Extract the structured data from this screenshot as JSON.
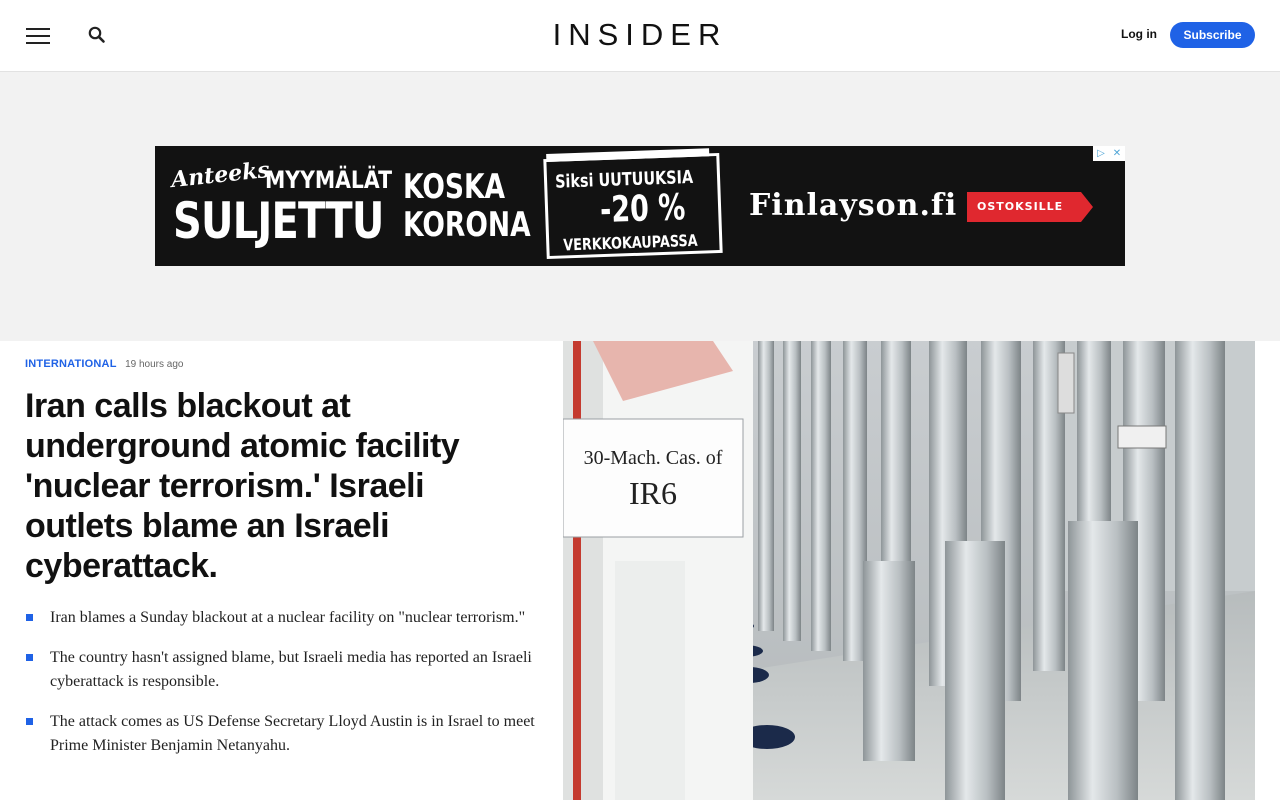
{
  "header": {
    "logo": "INSIDER",
    "login": "Log in",
    "subscribe": "Subscribe",
    "icons": [
      "hamburger-menu-icon",
      "search-icon"
    ]
  },
  "ad": {
    "line1": "Anteeks",
    "line2": "MYYMÄLÄT",
    "line3": "SULJETTU",
    "line4a": "KOSKA",
    "line4b": "KORONA",
    "box_line1": "Siksi UUTUUKSIA",
    "box_line2": "-20 %",
    "box_line3": "VERKKOKAUPASSA",
    "brand": "Finlayson.fi",
    "cta": "OSTOKSILLE"
  },
  "article": {
    "category": "INTERNATIONAL",
    "time": "19 hours ago",
    "headline": "Iran calls blackout at underground atomic facility 'nuclear terrorism.' Israeli outlets blame an Israeli cyberattack.",
    "bullets": [
      "Iran blames a Sunday blackout at a nuclear facility on \"nuclear terrorism.\"",
      "The country hasn't assigned blame, but Israeli media has reported an Israeli cyberattack is responsible.",
      "The attack comes as US Defense Secretary Lloyd Austin is in Israel to meet Prime Minister Benjamin Netanyahu."
    ],
    "image": {
      "sign_line1": "30-Mach. Cas. of",
      "sign_line2": "IR6"
    }
  },
  "colors": {
    "accent": "#1f62e6",
    "ad_background": "#121212",
    "ad_cta": "#e0282f"
  }
}
